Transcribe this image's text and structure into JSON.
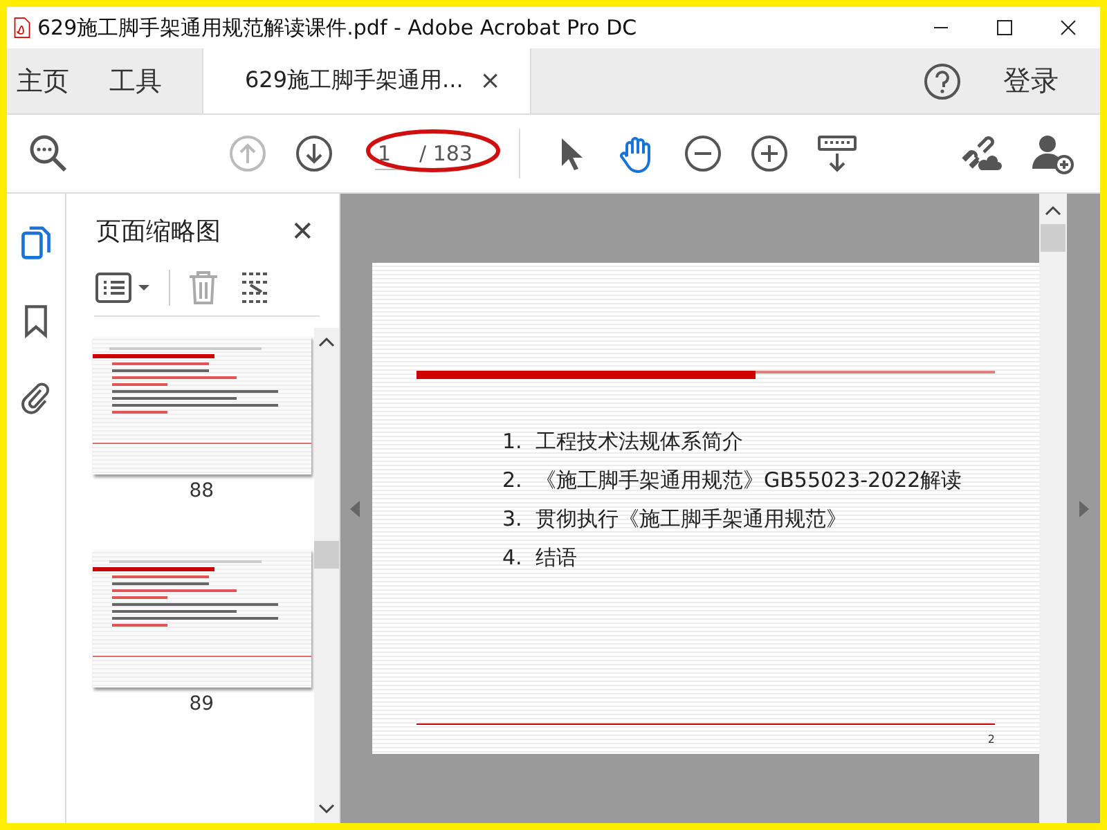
{
  "window": {
    "title": "629施工脚手架通用规范解读课件.pdf - Adobe Acrobat Pro DC"
  },
  "nav_tabs": [
    {
      "label": "主页",
      "selected": false
    },
    {
      "label": "工具",
      "selected": false
    }
  ],
  "document_tab": {
    "label": "629施工脚手架通用...",
    "selected": true,
    "close": "×"
  },
  "signin": "登录",
  "page_field": {
    "value": "1",
    "total": "/ 183"
  },
  "thumbnails_panel": {
    "title": "页面缩略图",
    "close": "✕"
  },
  "thumbnails": [
    {
      "label": "88"
    },
    {
      "label": "89"
    }
  ],
  "slide": {
    "items": [
      {
        "number": "1.",
        "text": "工程技术法规体系简介"
      },
      {
        "number": "2.",
        "text": "《施工脚手架通用规范》GB55023-2022解读"
      },
      {
        "number": "3.",
        "text": "贯彻执行《施工脚手架通用规范》"
      },
      {
        "number": "4.",
        "text": "结语"
      }
    ],
    "page_number": "2"
  }
}
